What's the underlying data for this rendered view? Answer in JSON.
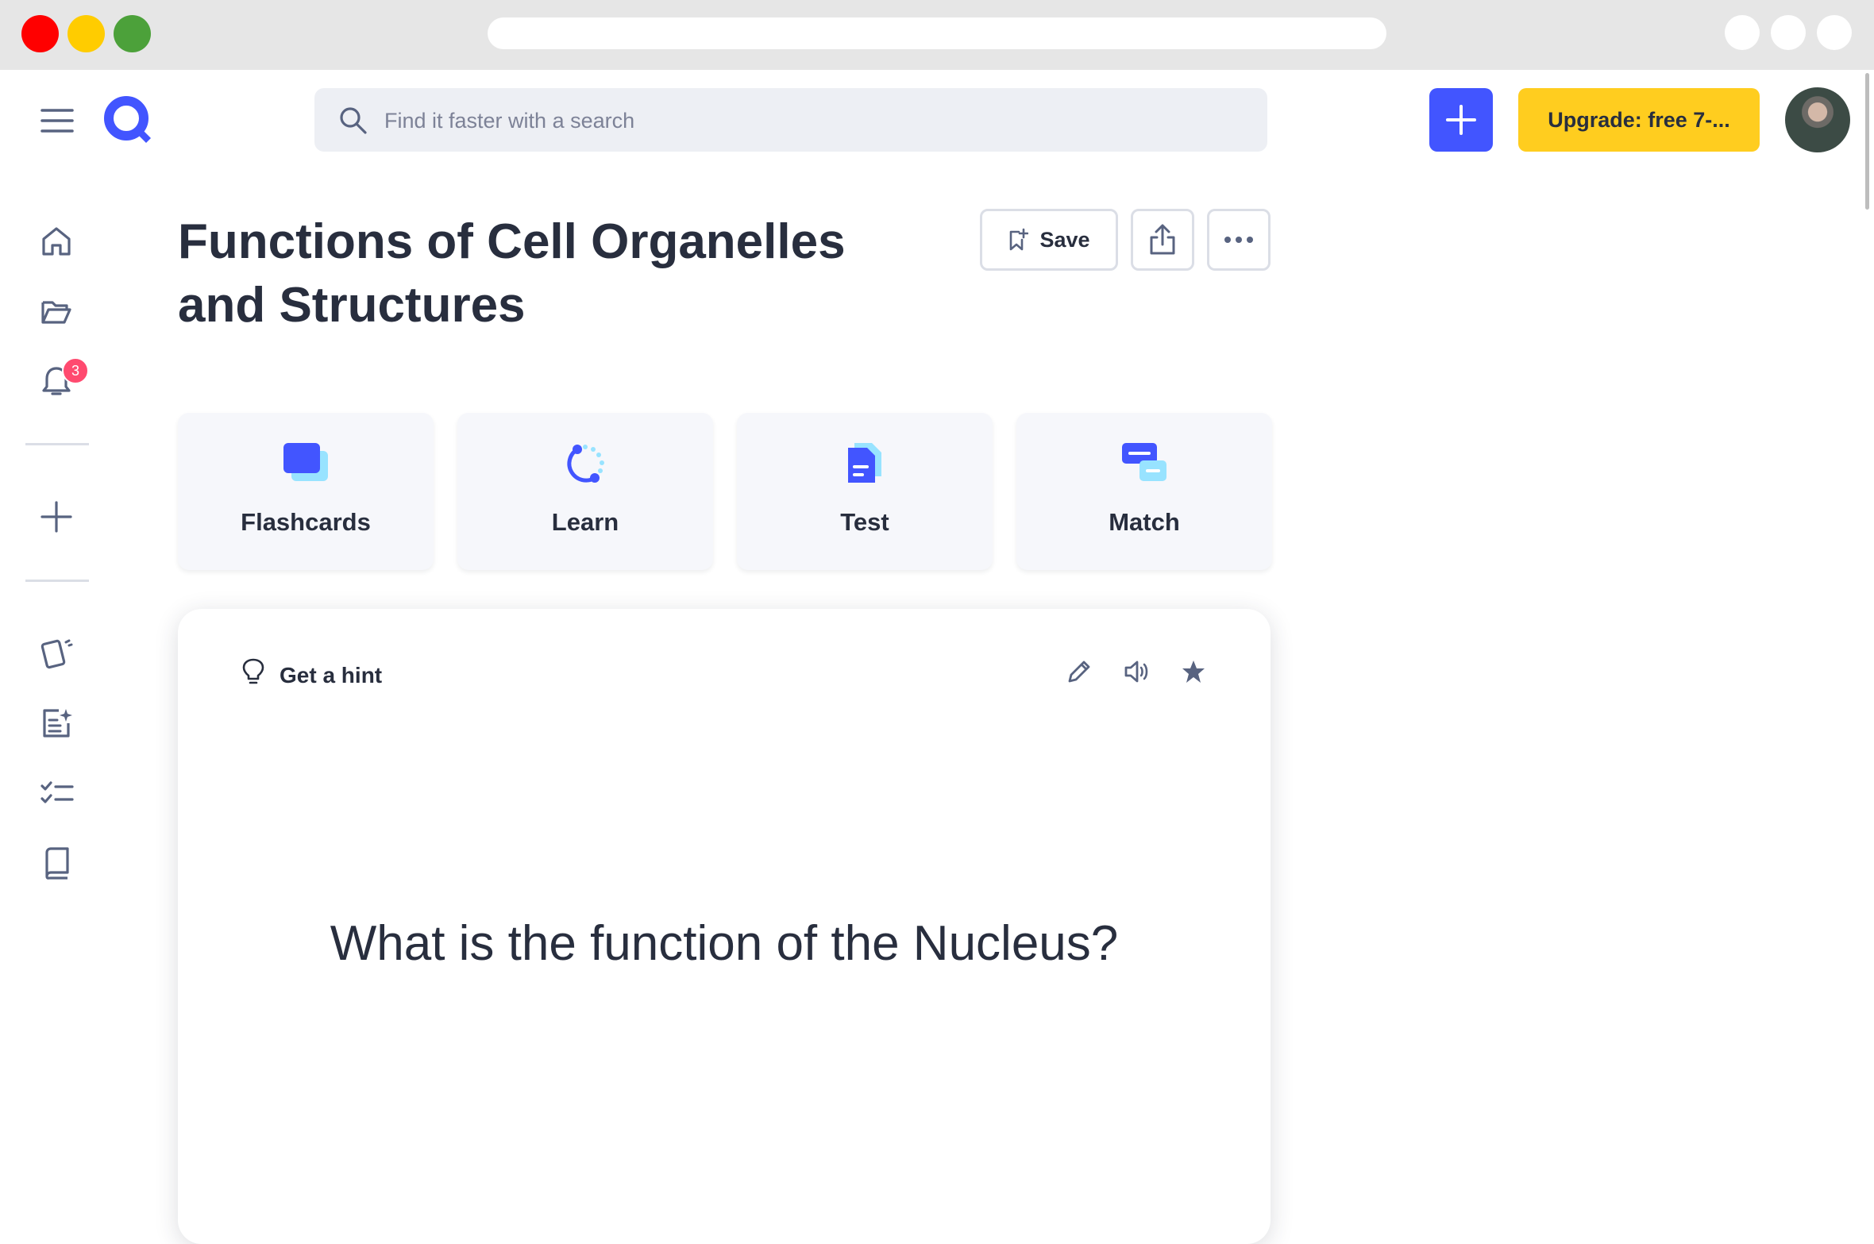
{
  "search": {
    "placeholder": "Find it faster with a search"
  },
  "topbar": {
    "upgrade_label": "Upgrade: free 7-..."
  },
  "sidebar": {
    "notification_count": "3"
  },
  "set": {
    "title_line1": "Functions of Cell Organelles",
    "title_line2": "and Structures",
    "save_label": "Save"
  },
  "modes": [
    {
      "label": "Flashcards",
      "icon": "flashcards-icon"
    },
    {
      "label": "Learn",
      "icon": "learn-icon"
    },
    {
      "label": "Test",
      "icon": "test-icon"
    },
    {
      "label": "Match",
      "icon": "match-icon"
    }
  ],
  "card": {
    "hint_label": "Get a hint",
    "question": "What is the function of the Nucleus?"
  },
  "colors": {
    "brand": "#4255ff",
    "upgrade": "#ffcd1f",
    "badge": "#ff4a6f",
    "text": "#282e3e",
    "icon_accent": "#98e3ff"
  }
}
